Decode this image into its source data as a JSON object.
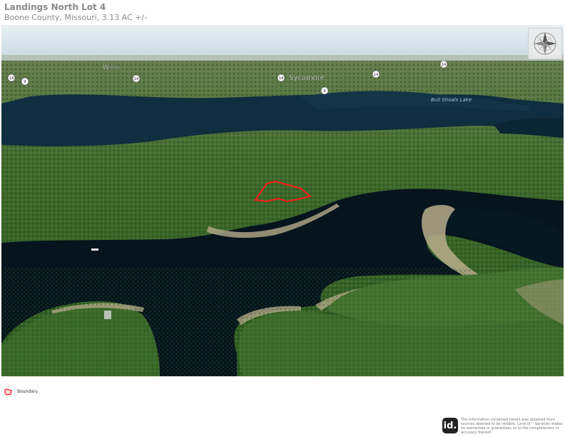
{
  "header": {
    "title": "Landings North Lot 4",
    "subtitle": "Boone County, Missouri, 3.13 AC +/-"
  },
  "map": {
    "places": [
      "Willis",
      "Sycamore",
      "Bull Shoals Lake"
    ],
    "route_shields": [
      "14",
      "9",
      "14",
      "14",
      "9",
      "14",
      "14"
    ],
    "compass_icon": "compass-rose-icon",
    "boundary_color": "#ff1a1a",
    "water_color": "#071a26",
    "land_color": "#3f6a2c"
  },
  "legend": {
    "boundary_label": "Boundary",
    "boundary_icon": "boundary-icon"
  },
  "footer": {
    "logo_text": "id.",
    "disclaimer": "The information contained herein was obtained from sources deemed to be reliable. Land id™ Services makes no warranties or guarantees as to the completeness or accuracy thereof."
  }
}
